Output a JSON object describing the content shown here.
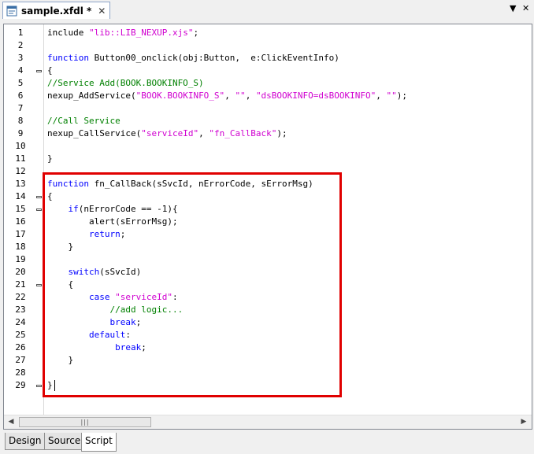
{
  "tab": {
    "title": "sample.xfdl *",
    "close": "✕"
  },
  "window_controls": {
    "menu": "▼",
    "close": "✕"
  },
  "gutter": {
    "fold_lines": [
      4,
      14,
      15,
      21,
      29
    ]
  },
  "code": [
    {
      "n": "1",
      "parts": [
        [
          "include ",
          "plain"
        ],
        [
          "\"lib::LIB_NEXUP.xjs\"",
          "str"
        ],
        [
          ";",
          "plain"
        ]
      ]
    },
    {
      "n": "2",
      "parts": []
    },
    {
      "n": "3",
      "parts": [
        [
          "function",
          "kw"
        ],
        [
          " Button00_onclick(obj:Button,  e:ClickEventInfo)",
          "plain"
        ]
      ]
    },
    {
      "n": "4",
      "parts": [
        [
          "{",
          "plain"
        ]
      ]
    },
    {
      "n": "5",
      "parts": [
        [
          "//Service Add(BOOK.BOOKINFO_S)",
          "cmt"
        ]
      ]
    },
    {
      "n": "6",
      "parts": [
        [
          "nexup_AddService(",
          "plain"
        ],
        [
          "\"BOOK.BOOKINFO_S\"",
          "str"
        ],
        [
          ", ",
          "plain"
        ],
        [
          "\"\"",
          "str"
        ],
        [
          ", ",
          "plain"
        ],
        [
          "\"dsBOOKINFO=dsBOOKINFO\"",
          "str"
        ],
        [
          ", ",
          "plain"
        ],
        [
          "\"\"",
          "str"
        ],
        [
          ");",
          "plain"
        ]
      ]
    },
    {
      "n": "7",
      "parts": []
    },
    {
      "n": "8",
      "parts": [
        [
          "//Call Service",
          "cmt"
        ]
      ]
    },
    {
      "n": "9",
      "parts": [
        [
          "nexup_CallService(",
          "plain"
        ],
        [
          "\"serviceId\"",
          "str"
        ],
        [
          ", ",
          "plain"
        ],
        [
          "\"fn_CallBack\"",
          "str"
        ],
        [
          ");",
          "plain"
        ]
      ]
    },
    {
      "n": "10",
      "parts": []
    },
    {
      "n": "11",
      "parts": [
        [
          "}",
          "plain"
        ]
      ]
    },
    {
      "n": "12",
      "parts": []
    },
    {
      "n": "13",
      "parts": [
        [
          "function",
          "kw"
        ],
        [
          " fn_CallBack(sSvcId, nErrorCode, sErrorMsg)",
          "plain"
        ]
      ]
    },
    {
      "n": "14",
      "parts": [
        [
          "{",
          "plain"
        ]
      ]
    },
    {
      "n": "15",
      "parts": [
        [
          "    ",
          "plain"
        ],
        [
          "if",
          "kw"
        ],
        [
          "(nErrorCode == -1){",
          "plain"
        ]
      ]
    },
    {
      "n": "16",
      "parts": [
        [
          "        alert(sErrorMsg);",
          "plain"
        ]
      ]
    },
    {
      "n": "17",
      "parts": [
        [
          "        ",
          "plain"
        ],
        [
          "return",
          "kw"
        ],
        [
          ";",
          "plain"
        ]
      ]
    },
    {
      "n": "18",
      "parts": [
        [
          "    }",
          "plain"
        ]
      ]
    },
    {
      "n": "19",
      "parts": []
    },
    {
      "n": "20",
      "parts": [
        [
          "    ",
          "plain"
        ],
        [
          "switch",
          "kw"
        ],
        [
          "(sSvcId)",
          "plain"
        ]
      ]
    },
    {
      "n": "21",
      "parts": [
        [
          "    {",
          "plain"
        ]
      ]
    },
    {
      "n": "22",
      "parts": [
        [
          "        ",
          "plain"
        ],
        [
          "case",
          "kw"
        ],
        [
          " ",
          "plain"
        ],
        [
          "\"serviceId\"",
          "str"
        ],
        [
          ":",
          "plain"
        ]
      ]
    },
    {
      "n": "23",
      "parts": [
        [
          "            ",
          "plain"
        ],
        [
          "//add logic...",
          "cmt"
        ]
      ]
    },
    {
      "n": "24",
      "parts": [
        [
          "            ",
          "plain"
        ],
        [
          "break",
          "kw"
        ],
        [
          ";",
          "plain"
        ]
      ]
    },
    {
      "n": "25",
      "parts": [
        [
          "        ",
          "plain"
        ],
        [
          "default",
          "kw"
        ],
        [
          ":",
          "plain"
        ]
      ]
    },
    {
      "n": "26",
      "parts": [
        [
          "             ",
          "plain"
        ],
        [
          "break",
          "kw"
        ],
        [
          ";",
          "plain"
        ]
      ]
    },
    {
      "n": "27",
      "parts": [
        [
          "    }",
          "plain"
        ]
      ]
    },
    {
      "n": "28",
      "parts": []
    },
    {
      "n": "29",
      "parts": [
        [
          "}",
          "plain"
        ]
      ],
      "caret": true
    }
  ],
  "scrollbar": {
    "left_arrow": "◀",
    "right_arrow": "▶",
    "thumb_grip": "|||"
  },
  "bottom_tabs": [
    {
      "label": "Design",
      "active": false
    },
    {
      "label": "Source",
      "active": false
    },
    {
      "label": "Script",
      "active": true
    }
  ]
}
